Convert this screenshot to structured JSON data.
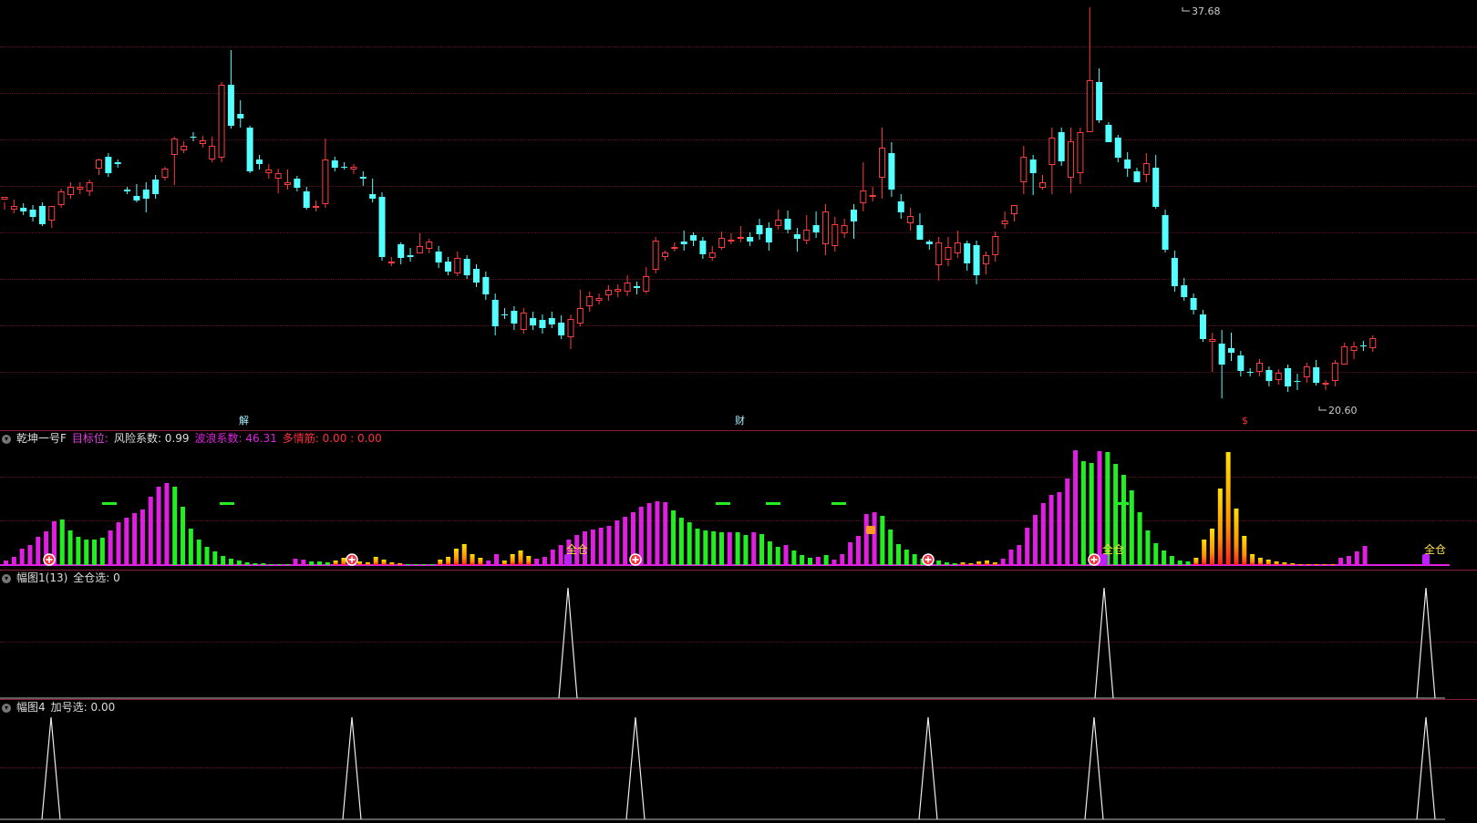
{
  "title_fragment": "",
  "main": {
    "high_label": "37.68",
    "low_label": "20.60",
    "markers": [
      {
        "text": "解",
        "color": "#a8f0ff"
      },
      {
        "text": "财",
        "color": "#a8f0ff"
      },
      {
        "text": "$",
        "color": "#ff3030"
      }
    ],
    "candles": [
      [
        219,
        216,
        222,
        230
      ],
      [
        230,
        226,
        219,
        234
      ],
      [
        228,
        232,
        223,
        236
      ],
      [
        230,
        238,
        225,
        243
      ],
      [
        226,
        246,
        222,
        248
      ],
      [
        242,
        226,
        239,
        250
      ],
      [
        225,
        210,
        207,
        228
      ],
      [
        214,
        205,
        200,
        218
      ],
      [
        208,
        205,
        200,
        213
      ],
      [
        210,
        200,
        197,
        215
      ],
      [
        185,
        175,
        174,
        192
      ],
      [
        172,
        190,
        168,
        194
      ],
      [
        178,
        180,
        175,
        184
      ],
      [
        208,
        210,
        205,
        213
      ],
      [
        215,
        220,
        202,
        222
      ],
      [
        208,
        218,
        200,
        233
      ],
      [
        197,
        213,
        192,
        218
      ],
      [
        195,
        185,
        183,
        198
      ],
      [
        170,
        152,
        150,
        203
      ],
      [
        165,
        160,
        155,
        168
      ],
      [
        150,
        150,
        145,
        155
      ],
      [
        158,
        154,
        149,
        162
      ],
      [
        175,
        160,
        150,
        178
      ],
      [
        173,
        93,
        90,
        178
      ],
      [
        93,
        138,
        55,
        141
      ],
      [
        125,
        130,
        110,
        140
      ],
      [
        140,
        188,
        138,
        190
      ],
      [
        175,
        180,
        170,
        186
      ],
      [
        190,
        186,
        180,
        196
      ],
      [
        196,
        190,
        185,
        212
      ],
      [
        203,
        200,
        186,
        208
      ],
      [
        196,
        206,
        193,
        210
      ],
      [
        210,
        228,
        205,
        230
      ],
      [
        228,
        226,
        220,
        232
      ],
      [
        224,
        175,
        152,
        228
      ],
      [
        176,
        184,
        172,
        188
      ],
      [
        183,
        183,
        178,
        186
      ],
      [
        186,
        183,
        180,
        191
      ],
      [
        194,
        196,
        188,
        204
      ],
      [
        213,
        218,
        196,
        222
      ],
      [
        216,
        282,
        211,
        286
      ],
      [
        288,
        287,
        282,
        292
      ],
      [
        268,
        283,
        266,
        290
      ],
      [
        280,
        282,
        272,
        287
      ],
      [
        278,
        270,
        256,
        275
      ],
      [
        273,
        265,
        262,
        278
      ],
      [
        276,
        288,
        270,
        294
      ],
      [
        287,
        298,
        282,
        302
      ],
      [
        300,
        283,
        276,
        303
      ],
      [
        284,
        302,
        280,
        306
      ],
      [
        295,
        310,
        290,
        315
      ],
      [
        304,
        323,
        298,
        329
      ],
      [
        329,
        358,
        322,
        368
      ],
      [
        345,
        345,
        338,
        350
      ],
      [
        341,
        355,
        336,
        362
      ],
      [
        362,
        343,
        338,
        366
      ],
      [
        349,
        357,
        342,
        362
      ],
      [
        351,
        360,
        345,
        366
      ],
      [
        349,
        356,
        342,
        360
      ],
      [
        354,
        368,
        346,
        372
      ],
      [
        370,
        350,
        345,
        383
      ],
      [
        355,
        338,
        318,
        358
      ],
      [
        336,
        325,
        320,
        342
      ],
      [
        330,
        327,
        322,
        334
      ],
      [
        324,
        318,
        313,
        330
      ],
      [
        320,
        317,
        312,
        326
      ],
      [
        320,
        310,
        302,
        325
      ],
      [
        314,
        316,
        309,
        323
      ],
      [
        320,
        303,
        293,
        322
      ],
      [
        296,
        264,
        260,
        300
      ],
      [
        282,
        277,
        275,
        286
      ],
      [
        273,
        271,
        266,
        276
      ],
      [
        265,
        268,
        253,
        275
      ],
      [
        258,
        264,
        255,
        270
      ],
      [
        264,
        279,
        260,
        284
      ],
      [
        283,
        277,
        270,
        286
      ],
      [
        272,
        261,
        254,
        274
      ],
      [
        264,
        263,
        256,
        268
      ],
      [
        262,
        260,
        248,
        266
      ],
      [
        260,
        265,
        255,
        270
      ],
      [
        247,
        257,
        240,
        263
      ],
      [
        250,
        266,
        244,
        275
      ],
      [
        248,
        241,
        230,
        252
      ],
      [
        240,
        252,
        231,
        256
      ],
      [
        257,
        262,
        250,
        276
      ],
      [
        264,
        252,
        236,
        268
      ],
      [
        247,
        255,
        232,
        261
      ],
      [
        268,
        232,
        224,
        280
      ],
      [
        270,
        246,
        238,
        276
      ],
      [
        256,
        247,
        240,
        261
      ],
      [
        230,
        243,
        224,
        262
      ],
      [
        223,
        209,
        178,
        232
      ],
      [
        216,
        214,
        205,
        221
      ],
      [
        195,
        162,
        140,
        218
      ],
      [
        168,
        208,
        156,
        216
      ],
      [
        221,
        233,
        213,
        240
      ],
      [
        245,
        237,
        228,
        253
      ],
      [
        247,
        263,
        234,
        258
      ],
      [
        265,
        268,
        263,
        274
      ],
      [
        291,
        266,
        260,
        308
      ],
      [
        285,
        271,
        260,
        292
      ],
      [
        278,
        266,
        253,
        283
      ],
      [
        267,
        289,
        264,
        297
      ],
      [
        269,
        302,
        264,
        312
      ],
      [
        290,
        280,
        276,
        301
      ],
      [
        280,
        259,
        254,
        287
      ],
      [
        246,
        242,
        232,
        251
      ],
      [
        235,
        225,
        225,
        243
      ],
      [
        200,
        172,
        160,
        213
      ],
      [
        175,
        190,
        170,
        214
      ],
      [
        206,
        200,
        192,
        208
      ],
      [
        181,
        151,
        140,
        213
      ],
      [
        145,
        177,
        140,
        182
      ],
      [
        195,
        155,
        140,
        212
      ],
      [
        190,
        145,
        140,
        202
      ],
      [
        145,
        88,
        8,
        145
      ],
      [
        90,
        132,
        75,
        135
      ],
      [
        137,
        156,
        134,
        140
      ],
      [
        151,
        173,
        148,
        178
      ],
      [
        175,
        185,
        167,
        194
      ],
      [
        188,
        200,
        184,
        193
      ],
      [
        192,
        179,
        168,
        200
      ],
      [
        184,
        227,
        170,
        229
      ],
      [
        236,
        274,
        230,
        277
      ],
      [
        283,
        314,
        275,
        320
      ],
      [
        313,
        326,
        305,
        330
      ],
      [
        327,
        340,
        322,
        345
      ],
      [
        345,
        372,
        340,
        375
      ],
      [
        375,
        372,
        365,
        408
      ],
      [
        377,
        400,
        362,
        437
      ],
      [
        382,
        387,
        365,
        396
      ],
      [
        390,
        407,
        385,
        413
      ],
      [
        408,
        409,
        404,
        413
      ],
      [
        408,
        398,
        394,
        413
      ],
      [
        406,
        418,
        402,
        424
      ],
      [
        417,
        409,
        405,
        422
      ],
      [
        404,
        424,
        400,
        430
      ],
      [
        418,
        418,
        410,
        428
      ],
      [
        414,
        402,
        398,
        420
      ],
      [
        403,
        420,
        395,
        423
      ],
      [
        422,
        420,
        417,
        428
      ],
      [
        418,
        398,
        395,
        424
      ],
      [
        400,
        380,
        376,
        400
      ],
      [
        385,
        380,
        375,
        394
      ],
      [
        379,
        380,
        374,
        385
      ],
      [
        382,
        371,
        368,
        386
      ]
    ]
  },
  "osc": {
    "name": "乾坤一号F",
    "target_label": "目标位:",
    "risk_label": "风险系数: 0.99",
    "wave_label": "波浪系数: 46.31",
    "sentiment_label": "多情筋: 0.00 : 0.00",
    "full_position_label": "全仓",
    "bars": [
      [
        5,
        "m"
      ],
      [
        9,
        "m"
      ],
      [
        18,
        "m"
      ],
      [
        22,
        "m"
      ],
      [
        31,
        "m"
      ],
      [
        37,
        "m"
      ],
      [
        48,
        "m"
      ],
      [
        50,
        "g"
      ],
      [
        38,
        "g"
      ],
      [
        31,
        "g"
      ],
      [
        28,
        "g"
      ],
      [
        28,
        "g"
      ],
      [
        30,
        "g"
      ],
      [
        38,
        "m"
      ],
      [
        47,
        "m"
      ],
      [
        52,
        "m"
      ],
      [
        57,
        "m"
      ],
      [
        61,
        "m"
      ],
      [
        75,
        "m"
      ],
      [
        86,
        "m"
      ],
      [
        90,
        "m"
      ],
      [
        86,
        "g"
      ],
      [
        64,
        "g"
      ],
      [
        40,
        "g"
      ],
      [
        28,
        "g"
      ],
      [
        20,
        "g"
      ],
      [
        15,
        "g"
      ],
      [
        10,
        "g"
      ],
      [
        7,
        "g"
      ],
      [
        5,
        "g"
      ],
      [
        3,
        "g"
      ],
      [
        2,
        "g"
      ],
      [
        2,
        "g"
      ],
      [
        1,
        "g"
      ],
      [
        1,
        "g"
      ],
      [
        1,
        "g"
      ],
      [
        7,
        "m"
      ],
      [
        6,
        "m"
      ],
      [
        4,
        "g"
      ],
      [
        4,
        "g"
      ],
      [
        3,
        "g"
      ],
      [
        5,
        "y"
      ],
      [
        8,
        "y"
      ],
      [
        6,
        "y"
      ],
      [
        4,
        "y"
      ],
      [
        3,
        "y"
      ],
      [
        9,
        "y"
      ],
      [
        6,
        "y"
      ],
      [
        3,
        "y"
      ],
      [
        2,
        "y"
      ],
      [
        1,
        "g"
      ],
      [
        1,
        "g"
      ],
      [
        1,
        "g"
      ],
      [
        1,
        "g"
      ],
      [
        6,
        "y"
      ],
      [
        9,
        "y"
      ],
      [
        18,
        "y"
      ],
      [
        23,
        "y"
      ],
      [
        12,
        "y"
      ],
      [
        8,
        "y"
      ],
      [
        5,
        "m"
      ],
      [
        12,
        "m"
      ],
      [
        5,
        "y"
      ],
      [
        12,
        "y"
      ],
      [
        16,
        "y"
      ],
      [
        10,
        "y"
      ],
      [
        7,
        "m"
      ],
      [
        9,
        "m"
      ],
      [
        17,
        "m"
      ],
      [
        22,
        "m"
      ],
      [
        28,
        "m"
      ],
      [
        33,
        "m"
      ],
      [
        37,
        "m"
      ],
      [
        39,
        "m"
      ],
      [
        41,
        "m"
      ],
      [
        43,
        "m"
      ],
      [
        49,
        "m"
      ],
      [
        53,
        "m"
      ],
      [
        58,
        "m"
      ],
      [
        64,
        "m"
      ],
      [
        68,
        "m"
      ],
      [
        70,
        "m"
      ],
      [
        69,
        "m"
      ],
      [
        60,
        "g"
      ],
      [
        52,
        "g"
      ],
      [
        47,
        "g"
      ],
      [
        40,
        "g"
      ],
      [
        38,
        "g"
      ],
      [
        37,
        "g"
      ],
      [
        36,
        "g"
      ],
      [
        36,
        "m"
      ],
      [
        36,
        "g"
      ],
      [
        33,
        "g"
      ],
      [
        36,
        "m"
      ],
      [
        34,
        "g"
      ],
      [
        26,
        "g"
      ],
      [
        20,
        "g"
      ],
      [
        22,
        "m"
      ],
      [
        16,
        "g"
      ],
      [
        11,
        "g"
      ],
      [
        8,
        "g"
      ],
      [
        9,
        "m"
      ],
      [
        11,
        "g"
      ],
      [
        6,
        "m"
      ],
      [
        12,
        "m"
      ],
      [
        25,
        "m"
      ],
      [
        32,
        "m"
      ],
      [
        56,
        "m"
      ],
      [
        58,
        "m"
      ],
      [
        54,
        "g"
      ],
      [
        39,
        "g"
      ],
      [
        23,
        "g"
      ],
      [
        17,
        "g"
      ],
      [
        12,
        "g"
      ],
      [
        7,
        "g"
      ],
      [
        5,
        "g"
      ],
      [
        5,
        "g"
      ],
      [
        3,
        "g"
      ],
      [
        2,
        "g"
      ],
      [
        3,
        "y"
      ],
      [
        2,
        "y"
      ],
      [
        4,
        "y"
      ],
      [
        5,
        "y"
      ],
      [
        3,
        "y"
      ],
      [
        7,
        "m"
      ],
      [
        17,
        "m"
      ],
      [
        22,
        "m"
      ],
      [
        41,
        "m"
      ],
      [
        55,
        "m"
      ],
      [
        68,
        "m"
      ],
      [
        77,
        "m"
      ],
      [
        80,
        "m"
      ],
      [
        95,
        "m"
      ],
      [
        126,
        "m"
      ],
      [
        114,
        "g"
      ],
      [
        112,
        "g"
      ],
      [
        125,
        "m"
      ],
      [
        124,
        "g"
      ],
      [
        111,
        "g"
      ],
      [
        99,
        "g"
      ],
      [
        82,
        "g"
      ],
      [
        58,
        "g"
      ],
      [
        38,
        "g"
      ],
      [
        24,
        "g"
      ],
      [
        16,
        "g"
      ],
      [
        10,
        "g"
      ],
      [
        5,
        "g"
      ],
      [
        4,
        "g"
      ],
      [
        8,
        "y"
      ],
      [
        28,
        "y"
      ],
      [
        40,
        "y"
      ],
      [
        84,
        "y"
      ],
      [
        124,
        "y"
      ],
      [
        62,
        "y"
      ],
      [
        32,
        "y"
      ],
      [
        12,
        "y"
      ],
      [
        8,
        "y"
      ],
      [
        6,
        "y"
      ],
      [
        4,
        "y"
      ],
      [
        3,
        "y"
      ],
      [
        2,
        "y"
      ],
      [
        1,
        "y"
      ],
      [
        1,
        "y"
      ],
      [
        1,
        "y"
      ],
      [
        1,
        "y"
      ],
      [
        1,
        "y"
      ],
      [
        8,
        "m"
      ],
      [
        10,
        "m"
      ],
      [
        15,
        "m"
      ],
      [
        21,
        "m"
      ]
    ],
    "plus_markers": [
      54,
      386,
      697,
      1018,
      1200
    ],
    "full_markers": [
      623,
      1211,
      1564
    ],
    "dashes": [
      [
        120,
        551
      ],
      [
        249,
        551
      ],
      [
        793,
        551
      ],
      [
        848,
        551
      ],
      [
        920,
        551
      ],
      [
        1230,
        551
      ]
    ]
  },
  "fig1": {
    "name": "幅图1(13)",
    "label": "全仓选: 0",
    "spikes": [
      623,
      1211,
      1564
    ]
  },
  "fig4": {
    "name": "幅图4",
    "label": "加号选: 0.00",
    "spikes": [
      56,
      386,
      697,
      1018,
      1200,
      1564
    ]
  },
  "footer_fragment": ""
}
